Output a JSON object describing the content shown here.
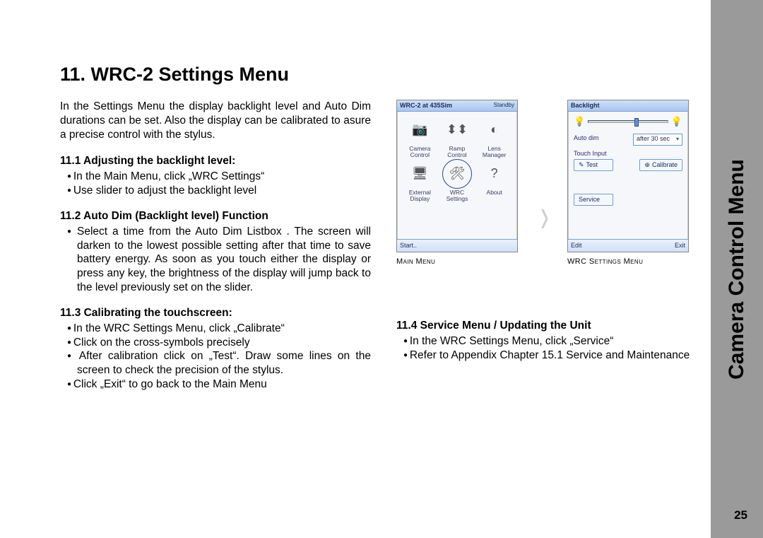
{
  "side_label": "Camera Control Menu",
  "page_number": "25",
  "title": "11. WRC-2 Settings Menu",
  "intro": "In the Settings Menu the display backlight level and Auto Dim durations can be set. Also the display can be calibrated to asure a precise control with the stylus.",
  "s11_1": {
    "head": "11.1 Adjusting the backlight level:",
    "b1": "In the Main Menu, click „WRC Settings“",
    "b2": "Use slider to adjust the backlight level"
  },
  "s11_2": {
    "head": "11.2 Auto Dim (Backlight level) Function",
    "b1": "Select a time from the Auto Dim Listbox . The screen will darken to the lowest possible setting after that time to save battery energy. As soon as you touch either the display or press any key, the brightness of the display will jump back to the level previously set on the slider."
  },
  "s11_3": {
    "head": "11.3 Calibrating the touchscreen:",
    "b1": "In the WRC Settings Menu, click „Calibrate“",
    "b2": "Click on the cross-symbols precisely",
    "b3": "After calibration click on „Test“. Draw some lines on the screen to check the precision of the stylus.",
    "b4": "Click „Exit“ to go back to the Main Menu"
  },
  "s11_4": {
    "head": "11.4 Service Menu / Updating the Unit",
    "b1": "In the WRC Settings Menu, click „Service“",
    "b2": "Refer to Appendix Chapter 15.1 Service and Maintenance"
  },
  "fig_main": {
    "caption": "Main Menu",
    "titlebar_left": "WRC-2 at 435Sim",
    "titlebar_right": "Standby",
    "foot_left": "Start..",
    "icons": {
      "camera_control": "Camera\nControl",
      "ramp_control": "Ramp\nControl",
      "lens_manager": "Lens\nManager",
      "external_display": "External\nDisplay",
      "wrc_settings": "WRC\nSettings",
      "about": "About"
    }
  },
  "fig_settings": {
    "caption": "WRC Settings Menu",
    "section_backlight": "Backlight",
    "section_autodim": "Auto dim",
    "autodim_value": "after 30 sec",
    "section_touch": "Touch Input",
    "btn_test": "Test",
    "btn_calibrate": "Calibrate",
    "btn_service": "Service",
    "foot_left": "Edit",
    "foot_right": "Exit"
  }
}
